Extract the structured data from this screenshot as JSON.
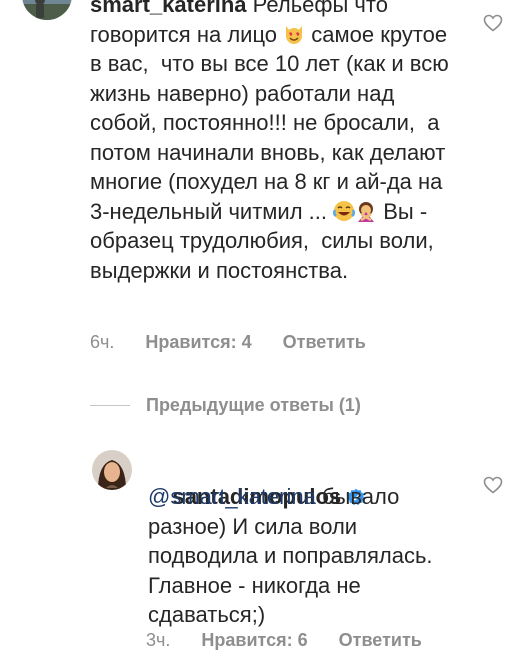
{
  "comment1": {
    "username": "smart_katerina",
    "text_part1": " Рельефы что говорится на лицо ",
    "emoji1": "heart-eyes-cat",
    "text_part2": " самое крутое в вас,  что вы все 10 лет (как и всю жизнь наверно) работали над собой, постоянно!!! не бросали,  а потом начинали вновь, как делают многие (похудел на 8 кг и ай-да на 3-недельный читмил ... ",
    "emoji2": "tears-of-joy",
    "emoji3": "person-gesturing-no",
    "text_part3": " Вы - образец трудолюбия,  силы воли, выдержки и постоянства.",
    "time": "6ч.",
    "likes": "Нравится: 4",
    "reply": "Ответить"
  },
  "replies_toggle": {
    "label": "Предыдущие ответы (1)"
  },
  "comment2": {
    "username": "santadimopulos",
    "mention": "@smart_katerina",
    "text": " бывало разное) И сила воли подводила и поправлялась. Главное - никогда не сдаваться;)",
    "time": "3ч.",
    "likes": "Нравится: 6",
    "reply": "Ответить"
  },
  "icons": {
    "like": "heart-outline-icon",
    "verified": "verified-badge-icon"
  },
  "colors": {
    "text": "#262626",
    "secondary": "#8e8e8e",
    "mention": "#1f3b6b",
    "verified": "#3897f0"
  }
}
